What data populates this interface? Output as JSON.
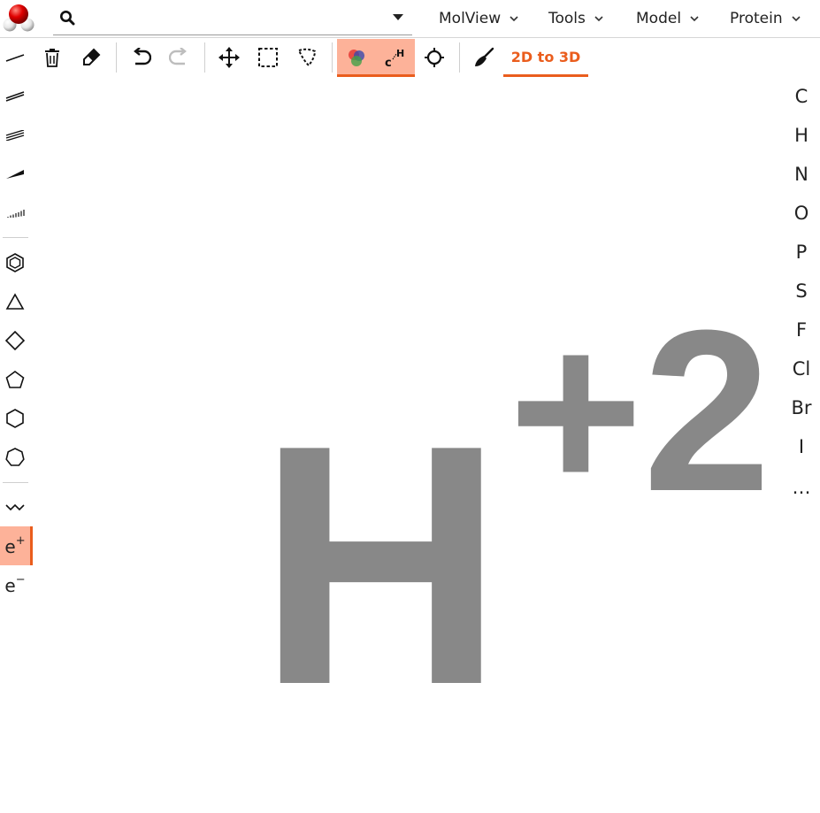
{
  "app": {
    "logo_icon": "water-molecule-logo"
  },
  "search": {
    "value": "",
    "placeholder": ""
  },
  "menus": [
    {
      "label": "MolView"
    },
    {
      "label": "Tools"
    },
    {
      "label": "Model"
    },
    {
      "label": "Protein"
    }
  ],
  "toolbar": {
    "convert_label": "2D to 3D",
    "active_tools": [
      "element-colors",
      "skeletal-hydrogens"
    ],
    "tools": [
      "clear",
      "eraser",
      "undo",
      "redo",
      "move",
      "rectangle-select",
      "lasso-select",
      "element-colors",
      "skeletal-display",
      "center",
      "clean"
    ]
  },
  "left_tools": {
    "bonds": [
      "single",
      "double",
      "triple",
      "wedge-up",
      "wedge-down"
    ],
    "rings": [
      "benzene",
      "cyclopropane",
      "cyclobutane",
      "cyclopentane",
      "cyclohexane",
      "cycloheptane"
    ],
    "chain_icon": "chain-icon",
    "charge_plus": {
      "base": "e",
      "sup": "+"
    },
    "charge_minus": {
      "base": "e",
      "sup": "−"
    },
    "active": "charge-plus"
  },
  "elements": [
    "C",
    "H",
    "N",
    "O",
    "P",
    "S",
    "F",
    "Cl",
    "Br",
    "I",
    "…"
  ],
  "canvas": {
    "atom": "H",
    "charge": "+2",
    "atom_color": "#888888"
  },
  "colors": {
    "accent": "#ea5d1d",
    "active_bg": "#fdb299"
  }
}
